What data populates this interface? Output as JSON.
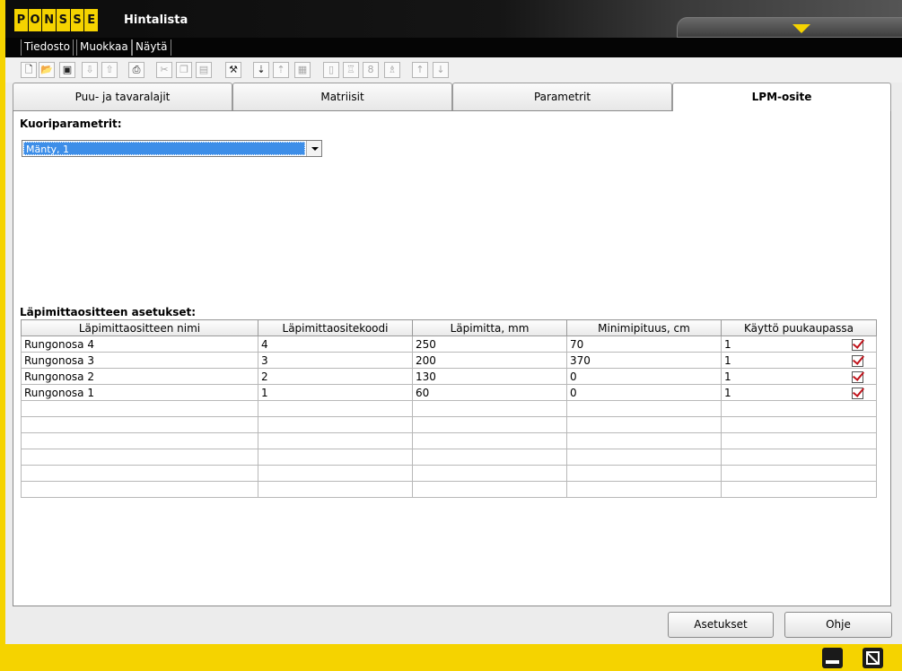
{
  "window": {
    "logo_letters": [
      "P",
      "O",
      "N",
      "S",
      "S",
      "E"
    ],
    "title": "Hintalista"
  },
  "menu": [
    "Tiedosto",
    "Muokkaa",
    "Näytä"
  ],
  "toolbar": {
    "icons": [
      "new-icon",
      "open-icon",
      "save-icon",
      "import-icon",
      "export-icon",
      "print-icon",
      "cut-icon",
      "copy-icon",
      "paste-icon",
      "tools-icon",
      "sort-asc-icon",
      "sort-desc-icon",
      "grid-icon",
      "log-icon",
      "log2-icon",
      "log3-icon",
      "log4-icon",
      "arrow-up-icon",
      "arrow-down-icon"
    ]
  },
  "tabs": [
    {
      "label": "Puu- ja tavaralajit",
      "active": false
    },
    {
      "label": "Matriisit",
      "active": false
    },
    {
      "label": "Parametrit",
      "active": false
    },
    {
      "label": "LPM-osite",
      "active": true
    }
  ],
  "bark": {
    "label": "Kuoriparametrit:",
    "selected": "Mänty, 1"
  },
  "diameter_settings": {
    "label": "Läpimittaosittee n asetukset:",
    "columns": [
      "Läpimittaositteen nimi",
      "Läpimittaositekoodi",
      "Läpimitta, mm",
      "Minimipituus, cm",
      "Käyttö puukaupassa"
    ],
    "rows": [
      {
        "name": "Rungonosa 4",
        "code": "4",
        "diameter": "250",
        "min_length": "70",
        "usage": "1",
        "checked": true
      },
      {
        "name": "Rungonosa 3",
        "code": "3",
        "diameter": "200",
        "min_length": "370",
        "usage": "1",
        "checked": true
      },
      {
        "name": "Rungonosa 2",
        "code": "2",
        "diameter": "130",
        "min_length": "0",
        "usage": "1",
        "checked": true
      },
      {
        "name": "Rungonosa 1",
        "code": "1",
        "diameter": "60",
        "min_length": "0",
        "usage": "1",
        "checked": true
      }
    ],
    "empty_rows": 6
  },
  "buttons": {
    "settings": "Asetukset",
    "help": "Ohje"
  },
  "colors": {
    "brand_yellow": "#f5d300",
    "selection_blue": "#3d8ee8",
    "check_red": "#c0141c"
  }
}
